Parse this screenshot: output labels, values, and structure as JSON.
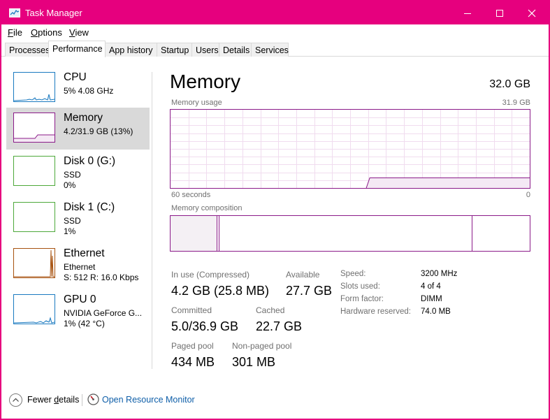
{
  "window": {
    "title": "Task Manager",
    "accent": "#e6007e",
    "controls": [
      "minimize",
      "maximize",
      "close"
    ]
  },
  "menu": [
    {
      "label": "File",
      "mnemonic": "F",
      "rest": "ile"
    },
    {
      "label": "Options",
      "mnemonic": "O",
      "rest": "ptions"
    },
    {
      "label": "View",
      "mnemonic": "V",
      "rest": "iew"
    }
  ],
  "tabs": [
    {
      "label": "Processes",
      "active": false
    },
    {
      "label": "Performance",
      "active": true
    },
    {
      "label": "App history",
      "active": false
    },
    {
      "label": "Startup",
      "active": false
    },
    {
      "label": "Users",
      "active": false
    },
    {
      "label": "Details",
      "active": false
    },
    {
      "label": "Services",
      "active": false
    }
  ],
  "sidebar": [
    {
      "name": "CPU",
      "lines": [
        "5%  4.08 GHz"
      ],
      "color": "#1a7ac0",
      "selected": false
    },
    {
      "name": "Memory",
      "lines": [
        "4.2/31.9 GB (13%)"
      ],
      "color": "#8b1a89",
      "selected": true
    },
    {
      "name": "Disk 0 (G:)",
      "lines": [
        "SSD",
        "0%"
      ],
      "color": "#4da83a",
      "selected": false
    },
    {
      "name": "Disk 1 (C:)",
      "lines": [
        "SSD",
        "1%"
      ],
      "color": "#4da83a",
      "selected": false
    },
    {
      "name": "Ethernet",
      "lines": [
        "Ethernet",
        "S: 512  R: 16.0 Kbps"
      ],
      "color": "#a7520f",
      "selected": false
    },
    {
      "name": "GPU 0",
      "lines": [
        "NVIDIA GeForce G...",
        "1%  (42 °C)"
      ],
      "color": "#1a7ac0",
      "selected": false
    }
  ],
  "memory": {
    "title": "Memory",
    "total": "32.0 GB",
    "usage_label": "Memory usage",
    "usage_max": "31.9 GB",
    "time_left": "60 seconds",
    "time_right": "0",
    "composition_label": "Memory composition",
    "color": "#8b1a89",
    "usage_fraction": 0.13,
    "composition": {
      "in_use_fraction": 0.13,
      "modified_fraction": 0.005,
      "standby_fraction": 0.705,
      "free_fraction": 0.16
    },
    "stats": {
      "in_use_label": "In use (Compressed)",
      "in_use_value": "4.2 GB (25.8 MB)",
      "available_label": "Available",
      "available_value": "27.7 GB",
      "committed_label": "Committed",
      "committed_value": "5.0/36.9 GB",
      "cached_label": "Cached",
      "cached_value": "22.7 GB",
      "paged_pool_label": "Paged pool",
      "paged_pool_value": "434 MB",
      "non_paged_pool_label": "Non-paged pool",
      "non_paged_pool_value": "301 MB"
    },
    "details": [
      {
        "label": "Speed:",
        "value": "3200 MHz"
      },
      {
        "label": "Slots used:",
        "value": "4 of 4"
      },
      {
        "label": "Form factor:",
        "value": "DIMM"
      },
      {
        "label": "Hardware reserved:",
        "value": "74.0 MB"
      }
    ]
  },
  "footer": {
    "fewer_details": "Fewer details",
    "fewer_mnemonic_prefix": "Fewer ",
    "fewer_mnemonic": "d",
    "fewer_rest": "etails",
    "resource_monitor": "Open Resource Monitor"
  }
}
